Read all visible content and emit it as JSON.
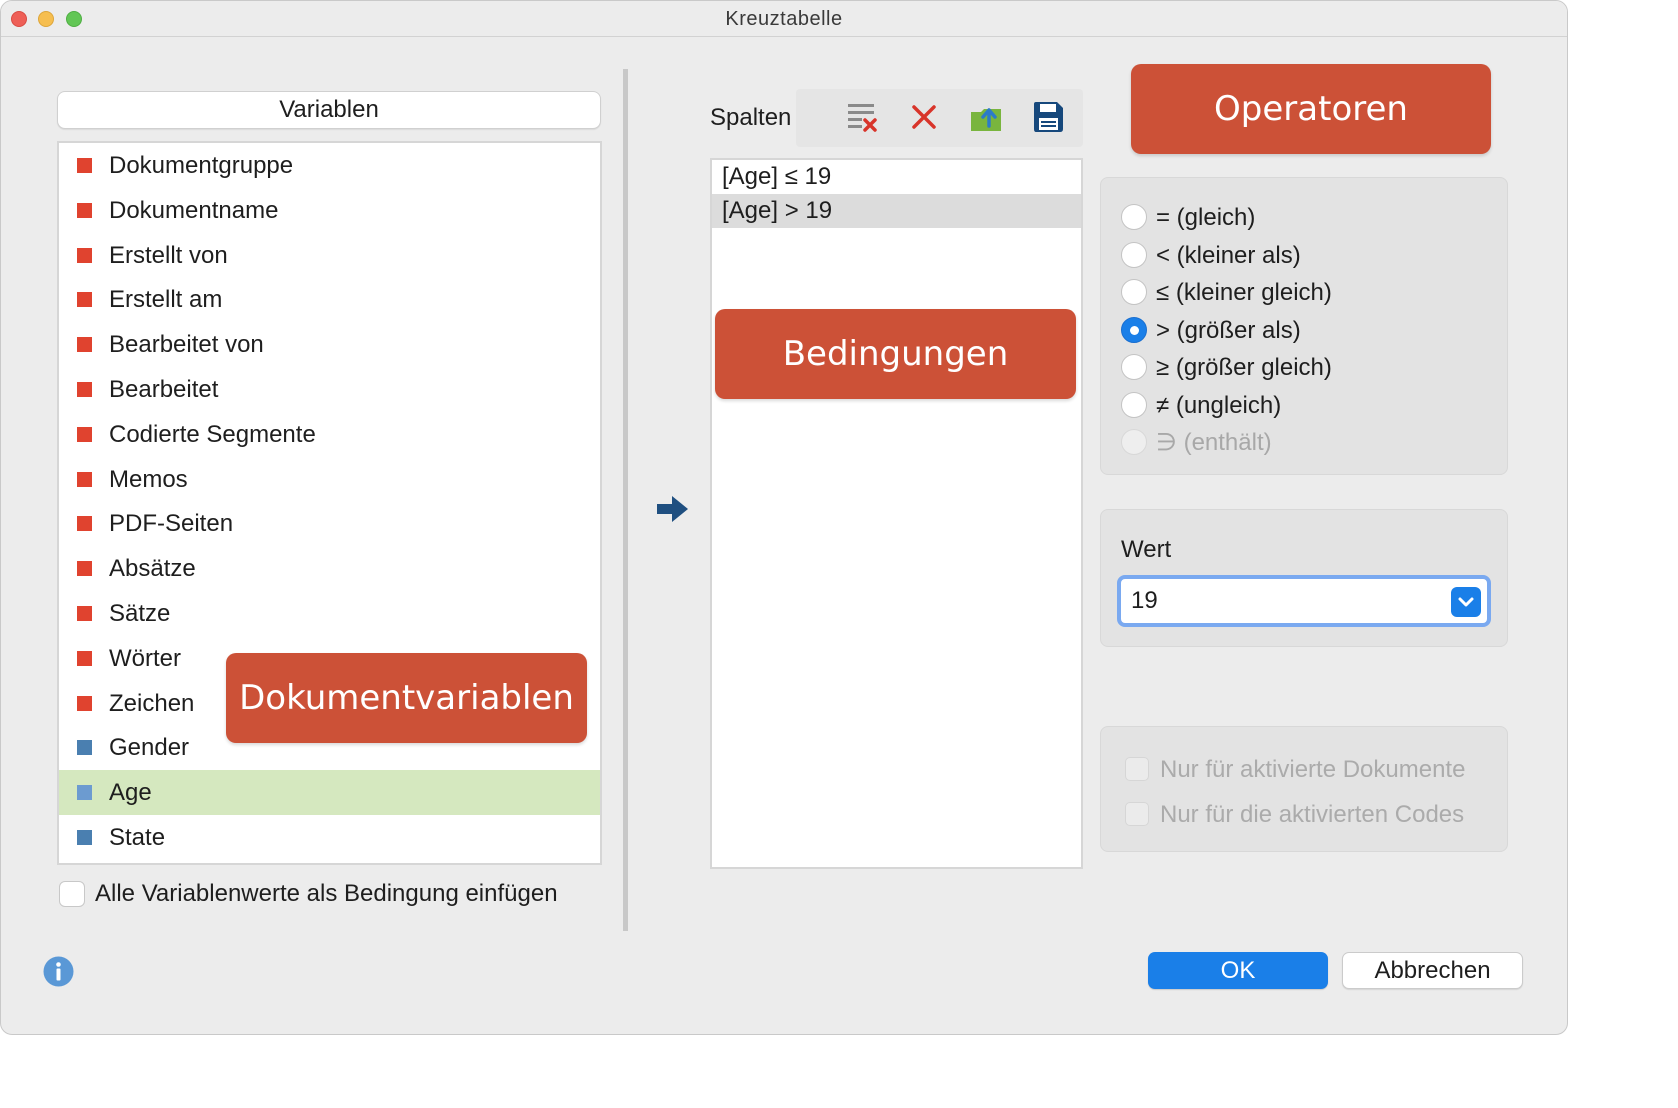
{
  "window": {
    "title": "Kreuztabelle"
  },
  "variables": {
    "header": "Variablen",
    "items": [
      {
        "label": "Dokumentgruppe",
        "color": "#e0432f",
        "selected": false
      },
      {
        "label": "Dokumentname",
        "color": "#e0432f",
        "selected": false
      },
      {
        "label": "Erstellt von",
        "color": "#e0432f",
        "selected": false
      },
      {
        "label": "Erstellt am",
        "color": "#e0432f",
        "selected": false
      },
      {
        "label": "Bearbeitet von",
        "color": "#e0432f",
        "selected": false
      },
      {
        "label": "Bearbeitet",
        "color": "#e0432f",
        "selected": false
      },
      {
        "label": "Codierte Segmente",
        "color": "#e0432f",
        "selected": false
      },
      {
        "label": "Memos",
        "color": "#e0432f",
        "selected": false
      },
      {
        "label": "PDF-Seiten",
        "color": "#e0432f",
        "selected": false
      },
      {
        "label": "Absätze",
        "color": "#e0432f",
        "selected": false
      },
      {
        "label": "Sätze",
        "color": "#e0432f",
        "selected": false
      },
      {
        "label": "Wörter",
        "color": "#e0432f",
        "selected": false
      },
      {
        "label": "Zeichen",
        "color": "#e0432f",
        "selected": false
      },
      {
        "label": "Gender",
        "color": "#4a7fb0",
        "selected": false
      },
      {
        "label": "Age",
        "color": "#6c9bd0",
        "selected": true
      },
      {
        "label": "State",
        "color": "#4a7fb0",
        "selected": false
      }
    ],
    "insert_all_label": "Alle Variablenwerte als Bedingung einfügen"
  },
  "columns": {
    "label": "Spalten",
    "toolbar": [
      "clear-list-icon",
      "delete-icon",
      "export-icon",
      "save-icon"
    ],
    "conditions": [
      {
        "text": "[Age] ≤ 19",
        "selected": false
      },
      {
        "text": "[Age] > 19",
        "selected": true
      }
    ]
  },
  "callouts": {
    "operators": "Operatoren",
    "conditions": "Bedingungen",
    "document_variables": "Dokumentvariablen"
  },
  "operators": {
    "items": [
      {
        "label": "= (gleich)",
        "checked": false,
        "enabled": true
      },
      {
        "label": "< (kleiner als)",
        "checked": false,
        "enabled": true
      },
      {
        "label": "≤ (kleiner gleich)",
        "checked": false,
        "enabled": true
      },
      {
        "label": "> (größer als)",
        "checked": true,
        "enabled": true
      },
      {
        "label": "≥ (größer gleich)",
        "checked": false,
        "enabled": true
      },
      {
        "label": "≠ (ungleich)",
        "checked": false,
        "enabled": true
      },
      {
        "label": "∋ (enthält)",
        "checked": false,
        "enabled": false
      }
    ]
  },
  "value": {
    "label": "Wert",
    "current": "19"
  },
  "options": {
    "only_active_documents": "Nur für aktivierte Dokumente",
    "only_active_codes": "Nur für die aktivierten Codes"
  },
  "buttons": {
    "ok": "OK",
    "cancel": "Abbrechen"
  },
  "colors": {
    "accent": "#1a7fe8",
    "callout": "#cc5137",
    "selection": "#d5e8bf"
  }
}
